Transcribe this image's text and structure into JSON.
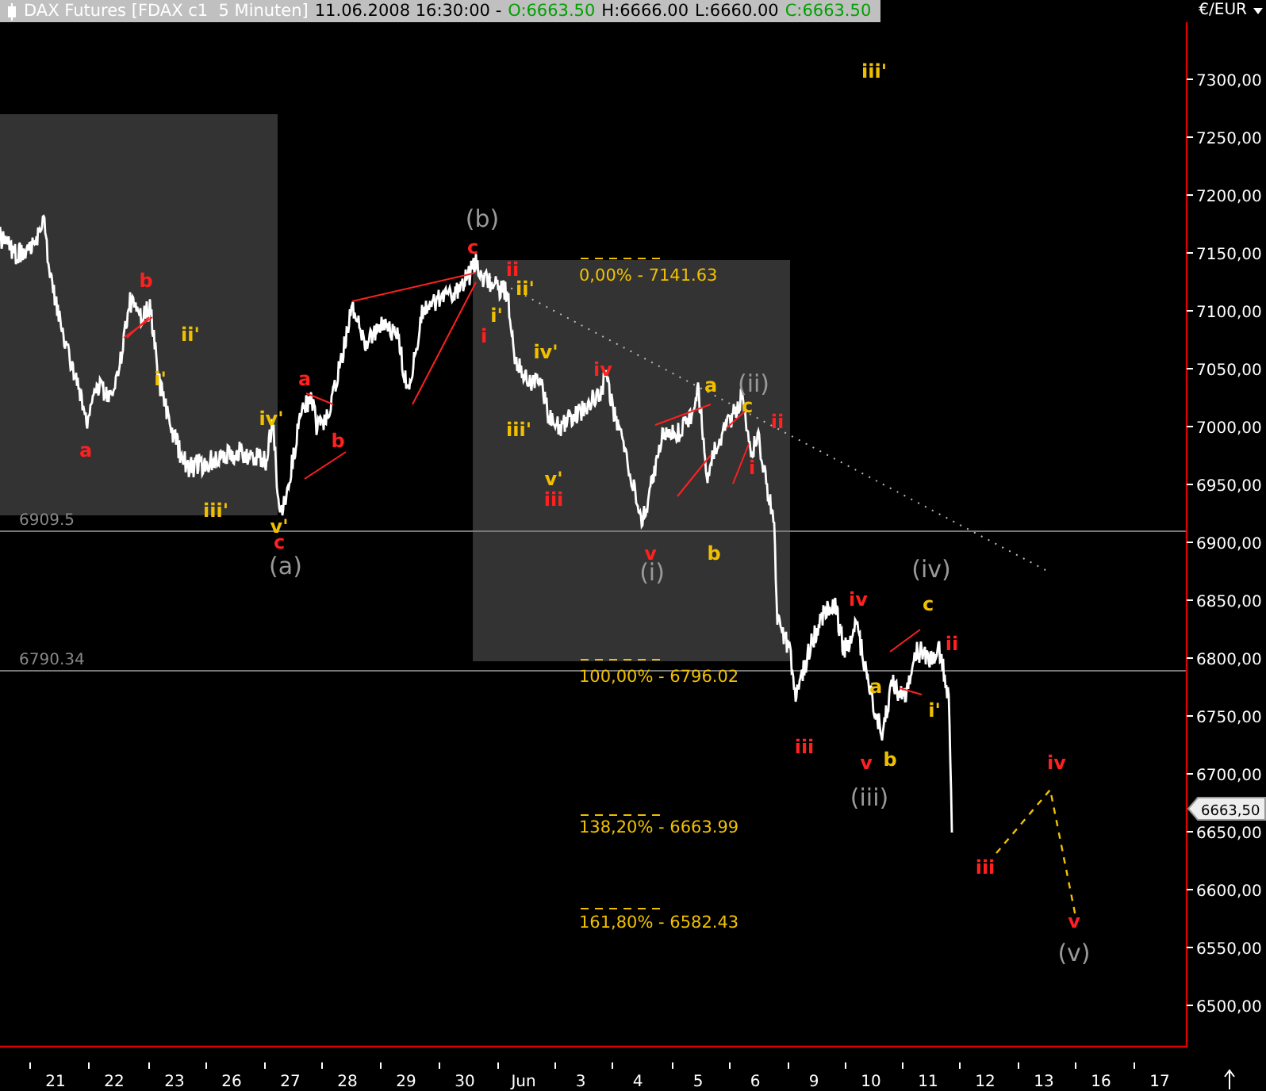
{
  "header": {
    "parts": [
      {
        "text": "DAX Futures [FDAX c1  5 Minuten]",
        "color": "#ffffff"
      },
      {
        "text": "11.06.2008 16:30:00 -",
        "color": "#000000"
      },
      {
        "text": "O:6663.50",
        "color": "#00a000"
      },
      {
        "text": "H:6666.00",
        "color": "#000000"
      },
      {
        "text": "L:6660.00",
        "color": "#000000"
      },
      {
        "text": "C:6663.50",
        "color": "#00a000"
      }
    ]
  },
  "y_axis": {
    "unit": "€/EUR",
    "labels": [
      "7300,00",
      "7250,00",
      "7200,00",
      "7150,00",
      "7100,00",
      "7050,00",
      "7000,00",
      "6950,00",
      "6900,00",
      "6850,00",
      "6800,00",
      "6750,00",
      "6700,00",
      "6650,00",
      "6600,00",
      "6550,00",
      "6500,00"
    ],
    "price_tag": "6663,50"
  },
  "x_axis": {
    "labels": [
      "21",
      "22",
      "23",
      "26",
      "27",
      "28",
      "29",
      "30",
      "Jun",
      "3",
      "4",
      "5",
      "6",
      "9",
      "10",
      "11",
      "12",
      "13",
      "16",
      "17"
    ]
  },
  "levels": [
    "6909.5",
    "6790.34"
  ],
  "fib_levels": [
    "0,00% - 7141.63",
    "100,00% - 6796.02",
    "138,20% - 6663.99",
    "161,80% - 6582.43"
  ],
  "wave_labels": [
    {
      "text": "iii'",
      "color": "#f0c000"
    },
    {
      "text": "(b)",
      "color": "#999999"
    },
    {
      "text": "c",
      "color": "#ff2020"
    },
    {
      "text": "ii",
      "color": "#ff2020"
    },
    {
      "text": "b",
      "color": "#ff2020"
    },
    {
      "text": "ii'",
      "color": "#f0c000"
    },
    {
      "text": "i'",
      "color": "#f0c000"
    },
    {
      "text": "ii'",
      "color": "#f0c000"
    },
    {
      "text": "i",
      "color": "#ff2020"
    },
    {
      "text": "iv'",
      "color": "#f0c000"
    },
    {
      "text": "i'",
      "color": "#f0c000"
    },
    {
      "text": "iv",
      "color": "#ff2020"
    },
    {
      "text": "a",
      "color": "#ff2020"
    },
    {
      "text": "a",
      "color": "#f0c000"
    },
    {
      "text": "(ii)",
      "color": "#999999"
    },
    {
      "text": "c",
      "color": "#f0c000"
    },
    {
      "text": "iv'",
      "color": "#f0c000"
    },
    {
      "text": "ii",
      "color": "#ff2020"
    },
    {
      "text": "iii'",
      "color": "#f0c000"
    },
    {
      "text": "b",
      "color": "#ff2020"
    },
    {
      "text": "a",
      "color": "#ff2020"
    },
    {
      "text": "i",
      "color": "#ff2020"
    },
    {
      "text": "v'",
      "color": "#f0c000"
    },
    {
      "text": "iii",
      "color": "#ff2020"
    },
    {
      "text": "iii'",
      "color": "#f0c000"
    },
    {
      "text": "v'",
      "color": "#f0c000"
    },
    {
      "text": "c",
      "color": "#ff2020"
    },
    {
      "text": "v",
      "color": "#ff2020"
    },
    {
      "text": "b",
      "color": "#f0c000"
    },
    {
      "text": "(a)",
      "color": "#999999"
    },
    {
      "text": "(i)",
      "color": "#999999"
    },
    {
      "text": "(iv)",
      "color": "#999999"
    },
    {
      "text": "iv",
      "color": "#ff2020"
    },
    {
      "text": "c",
      "color": "#f0c000"
    },
    {
      "text": "ii",
      "color": "#ff2020"
    },
    {
      "text": "a",
      "color": "#f0c000"
    },
    {
      "text": "i'",
      "color": "#f0c000"
    },
    {
      "text": "iii",
      "color": "#ff2020"
    },
    {
      "text": "v",
      "color": "#ff2020"
    },
    {
      "text": "b",
      "color": "#f0c000"
    },
    {
      "text": "iv",
      "color": "#ff2020"
    },
    {
      "text": "(iii)",
      "color": "#999999"
    },
    {
      "text": "iii",
      "color": "#ff2020"
    },
    {
      "text": "v",
      "color": "#ff2020"
    },
    {
      "text": "(v)",
      "color": "#999999"
    }
  ]
}
